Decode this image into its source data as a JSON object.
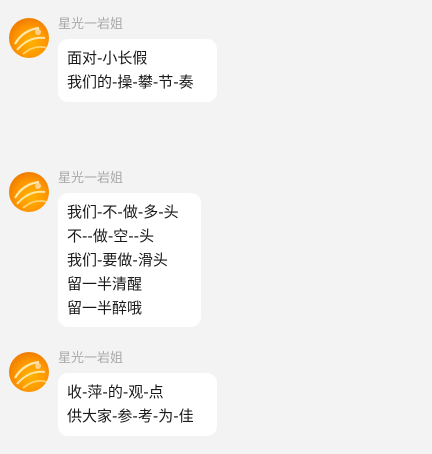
{
  "messages": [
    {
      "sender": "星光一岩姐",
      "lines": [
        "面对-小长假",
        "我们的-操-攀-节-奏"
      ]
    },
    {
      "sender": "星光一岩姐",
      "lines": [
        "我们-不-做-多-头",
        "不--做-空--头",
        "我们-要做-滑头",
        "留一半清醒",
        "留一半醉哦"
      ]
    },
    {
      "sender": "星光一岩姐",
      "lines": [
        "收-萍-的-观-点",
        "供大家-参-考-为-佳"
      ]
    }
  ]
}
